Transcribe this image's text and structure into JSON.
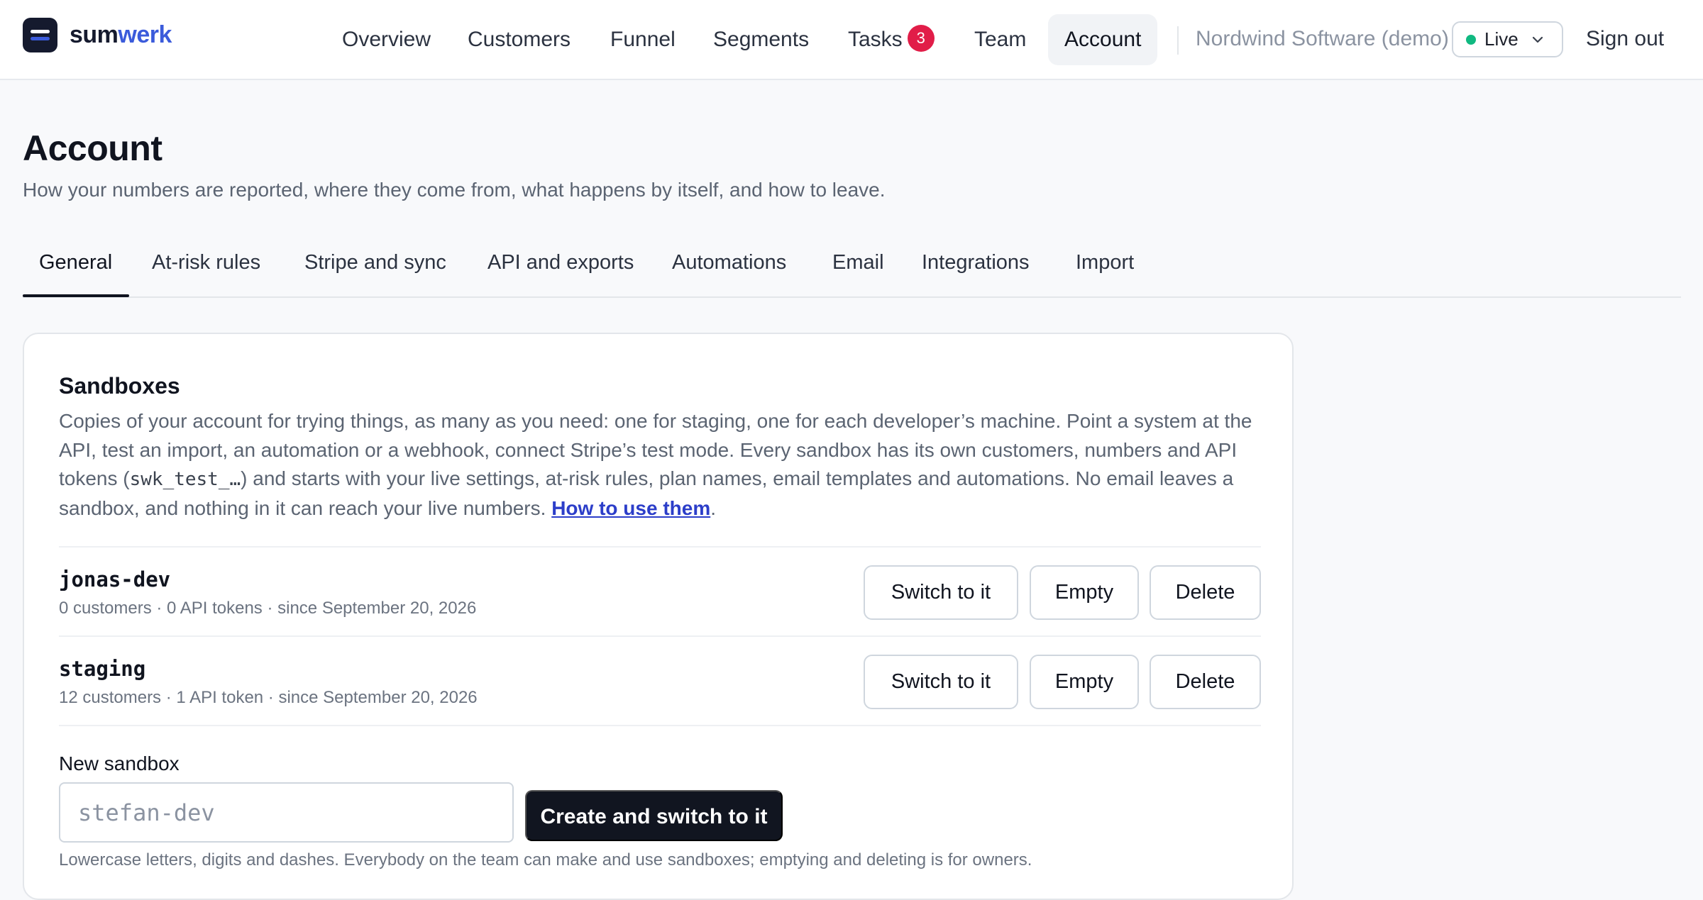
{
  "app": {
    "brand_prefix": "sum",
    "brand_accent": "werk",
    "brand_colors": {
      "mark": "#151a2e",
      "accent": "#3b5bdb"
    }
  },
  "nav": {
    "items": [
      {
        "label": "Overview"
      },
      {
        "label": "Customers"
      },
      {
        "label": "Funnel"
      },
      {
        "label": "Segments"
      },
      {
        "label": "Tasks",
        "badge": "3"
      },
      {
        "label": "Team"
      },
      {
        "label": "Account",
        "active": true
      }
    ],
    "org_name": "Nordwind Software (demo)",
    "environment": {
      "selected": "Live",
      "status_color": "#10b981",
      "icon": "chevron-down-icon"
    },
    "sign_out": "Sign out"
  },
  "page": {
    "title": "Account",
    "subtitle": "How your numbers are reported, where they come from, what happens by itself, and how to leave."
  },
  "tabs": [
    {
      "label": "General",
      "active": true
    },
    {
      "label": "At-risk rules"
    },
    {
      "label": "Stripe and sync"
    },
    {
      "label": "API and exports"
    },
    {
      "label": "Automations"
    },
    {
      "label": "Email"
    },
    {
      "label": "Integrations"
    },
    {
      "label": "Import"
    }
  ],
  "sandboxes": {
    "title": "Sandboxes",
    "description_part1": "Copies of your account for trying things, as many as you need: one for staging, one for each developer’s machine. Point a system at the API, test an import, an automation or a webhook, connect Stripe’s test mode. Every sandbox has its own customers, numbers and API tokens (",
    "description_code": "swk_test_…",
    "description_part2": ") and starts with your live settings, at-risk rules, plan names, email templates and automations. No email leaves a sandbox, and nothing in it can reach your live numbers. ",
    "description_link": "How to use them",
    "description_end": ".",
    "rows": [
      {
        "name": "jonas-dev",
        "meta": "0 customers · 0 API tokens · since September 20, 2026",
        "switch_label": "Switch to it",
        "empty_label": "Empty",
        "delete_label": "Delete"
      },
      {
        "name": "staging",
        "meta": "12 customers · 1 API token · since September 20, 2026",
        "switch_label": "Switch to it",
        "empty_label": "Empty",
        "delete_label": "Delete"
      }
    ],
    "new_label": "New sandbox",
    "new_placeholder": "stefan-dev",
    "new_value": "",
    "create_label": "Create and switch to it",
    "help": "Lowercase letters, digits and dashes. Everybody on the team can make and use sandboxes; emptying and deleting is for owners."
  }
}
